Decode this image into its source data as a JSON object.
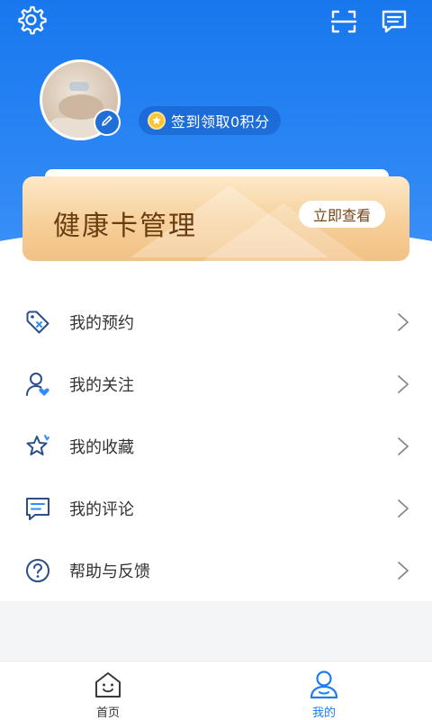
{
  "header": {
    "points_label": "签到领取0积分",
    "colors": {
      "primary": "#1e7cf0",
      "header_blue": "#2b86f4"
    },
    "icons": {
      "settings": "gear-icon",
      "scan": "scan-icon",
      "messages": "message-icon",
      "edit": "pencil-icon",
      "coin": "star-coin-icon"
    }
  },
  "health_card": {
    "title": "健康卡管理",
    "action_label": "立即查看"
  },
  "menu": {
    "items": [
      {
        "label": "我的预约",
        "icon": "appointment-tag-icon"
      },
      {
        "label": "我的关注",
        "icon": "follow-person-icon"
      },
      {
        "label": "我的收藏",
        "icon": "favorite-star-icon"
      },
      {
        "label": "我的评论",
        "icon": "comment-icon"
      },
      {
        "label": "帮助与反馈",
        "icon": "help-icon"
      }
    ]
  },
  "tabbar": {
    "tabs": [
      {
        "label": "首页",
        "icon": "home-icon",
        "active": false
      },
      {
        "label": "我的",
        "icon": "profile-icon",
        "active": true
      }
    ]
  }
}
